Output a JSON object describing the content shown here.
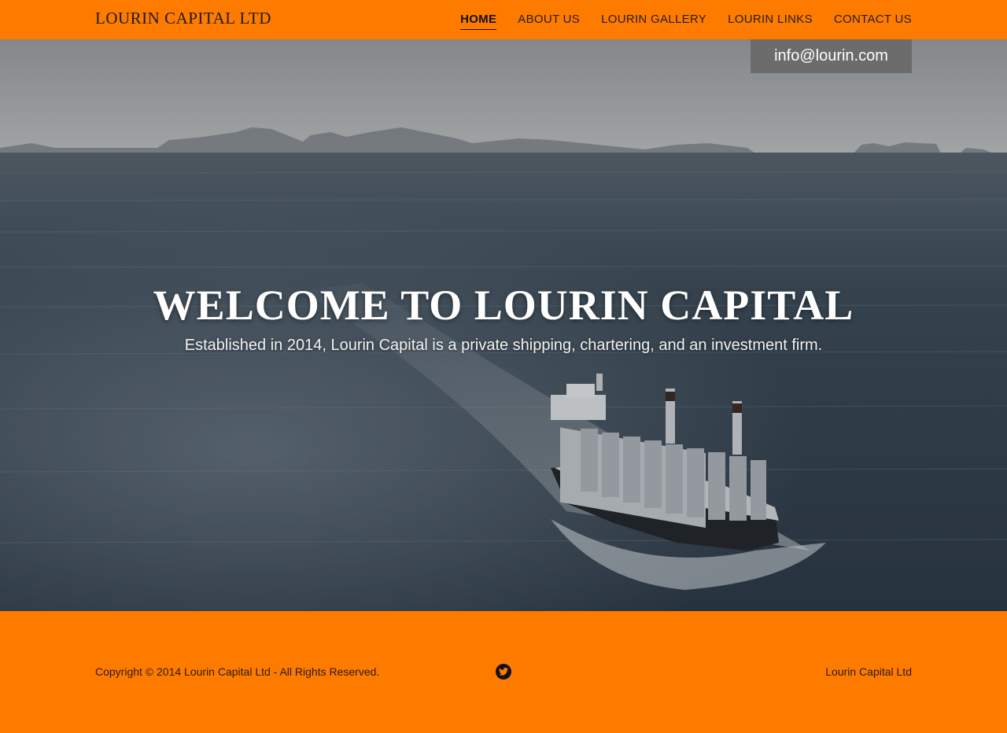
{
  "header": {
    "brand": "LOURIN CAPITAL LTD",
    "nav": [
      {
        "label": "HOME",
        "active": true
      },
      {
        "label": "ABOUT US"
      },
      {
        "label": "LOURIN GALLERY"
      },
      {
        "label": "LOURIN LINKS"
      },
      {
        "label": "CONTACT US"
      }
    ]
  },
  "email": "info@lourin.com",
  "hero": {
    "title": "WELCOME TO LOURIN CAPITAL",
    "subtitle": "Established in 2014, Lourin Capital is a private shipping, chartering, and an investment firm."
  },
  "footer": {
    "copyright": "Copyright © 2014 Lourin Capital Ltd - All Rights Reserved.",
    "social_icon": "twitter-icon",
    "brand": "Lourin Capital Ltd"
  },
  "colors": {
    "accent": "#ff7b00",
    "sea": "#3a4a5a",
    "sky": "#b9bcbd"
  }
}
